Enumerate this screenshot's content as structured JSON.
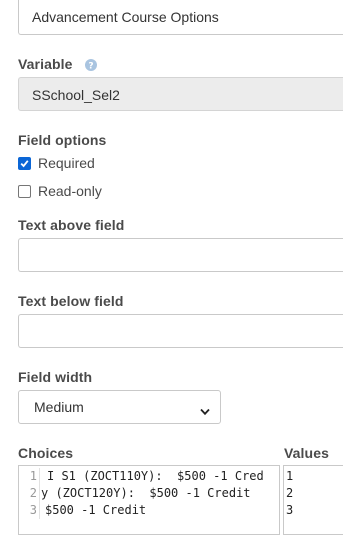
{
  "form": {
    "name_field_value": "Advancement Course Options",
    "variable": {
      "label": "Variable",
      "help_icon": "question-circle-icon",
      "value": "SSchool_Sel2"
    },
    "field_options": {
      "label": "Field options",
      "required_label": "Required",
      "required_checked": true,
      "readonly_label": "Read-only",
      "readonly_checked": false
    },
    "text_above": {
      "label": "Text above field",
      "value": ""
    },
    "text_below": {
      "label": "Text below field",
      "value": ""
    },
    "field_width": {
      "label": "Field width",
      "selected": "Medium",
      "icon": "chevron-down-icon"
    },
    "choices": {
      "label": "Choices",
      "line_numbers": [
        "1",
        "2",
        "3"
      ],
      "lines": [
        "I S1 (ZOCT110Y):  $500 -1 Cred",
        "y (ZOCT120Y):  $500 -1 Credit",
        "$500 -1 Credit"
      ]
    },
    "values": {
      "label": "Values",
      "lines": [
        "1",
        "2",
        "3"
      ]
    }
  },
  "colors": {
    "accent": "#0b66d6",
    "readonly_bg": "#ececec",
    "border": "#c9c9c9",
    "help_icon": "#a9c4e0"
  }
}
